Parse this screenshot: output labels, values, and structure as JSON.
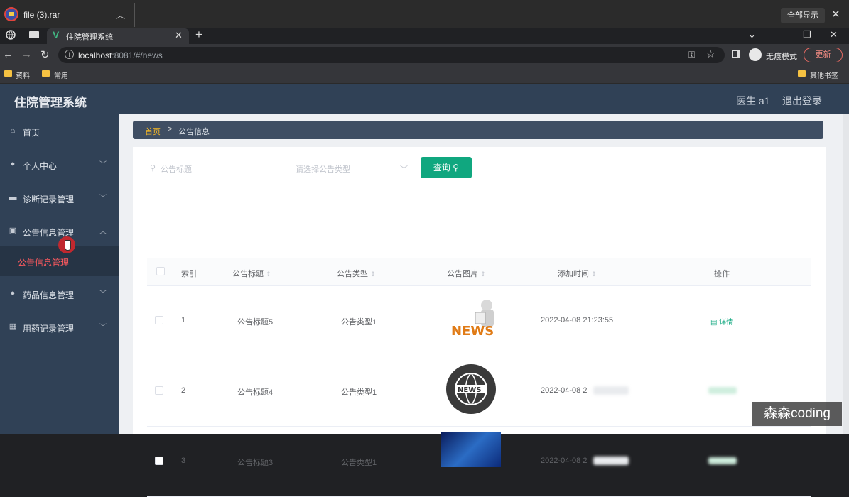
{
  "download": {
    "filename": "file (3).rar",
    "show_all": "全部显示"
  },
  "browser": {
    "tab_title": "住院管理系统",
    "url_host": "localhost",
    "url_rest": ":8081/#/news",
    "incognito_label": "无痕模式",
    "update_label": "更新"
  },
  "bookmarks": {
    "items": [
      "资料",
      "常用"
    ],
    "other": "其他书签"
  },
  "app": {
    "title": "住院管理系统",
    "user": "医生 a1",
    "logout": "退出登录"
  },
  "sidebar": {
    "items": [
      {
        "label": "首页",
        "icon": "home-icon"
      },
      {
        "label": "个人中心",
        "icon": "user-icon"
      },
      {
        "label": "诊断记录管理",
        "icon": "message-icon"
      },
      {
        "label": "公告信息管理",
        "icon": "clipboard-icon"
      },
      {
        "label": "药品信息管理",
        "icon": "pin-icon"
      },
      {
        "label": "用药记录管理",
        "icon": "calendar-icon"
      }
    ],
    "active_sub": "公告信息管理"
  },
  "breadcrumb": {
    "home": "首页",
    "current": "公告信息"
  },
  "search": {
    "title_placeholder": "公告标题",
    "type_placeholder": "请选择公告类型",
    "query_label": "查询"
  },
  "table": {
    "headers": [
      "索引",
      "公告标题",
      "公告类型",
      "公告图片",
      "添加时间",
      "操作"
    ],
    "rows": [
      {
        "index": "1",
        "title": "公告标题5",
        "type": "公告类型1",
        "time": "2022-04-08 21:23:55",
        "action": "详情"
      },
      {
        "index": "2",
        "title": "公告标题4",
        "type": "公告类型1",
        "time": "2022-04-08 2"
      },
      {
        "index": "3",
        "title": "公告标题3",
        "type": "公告类型1",
        "time": "2022-04-08 2"
      }
    ]
  },
  "watermark": "森森coding",
  "colors": {
    "primary": "#10a77f",
    "sidebar": "#304156",
    "active": "#ff5a5f",
    "breadcrumb_home": "#f7b924"
  }
}
